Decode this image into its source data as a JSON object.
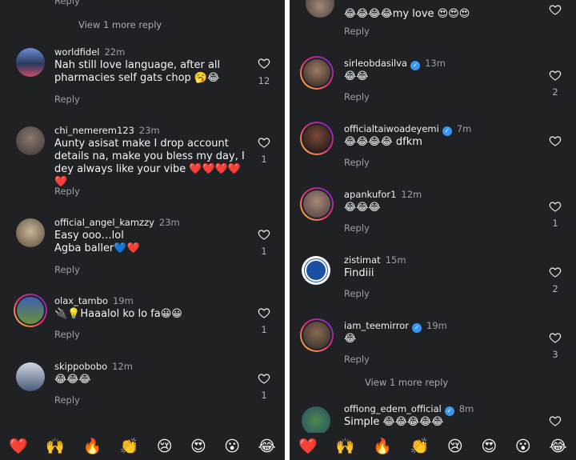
{
  "left": {
    "clipped_top_text": "Reply",
    "view_more": "View 1 more reply",
    "comments": [
      {
        "user": "worldfidel",
        "time": "22m",
        "text": "Nah still love language, after all pharmacies self gats chop 🥱😂",
        "reply": "Reply",
        "likes": "12",
        "verified": false
      },
      {
        "user": "chi_nemerem123",
        "time": "23m",
        "text": "Aunty asisat make I drop account details na, make you bless my day, I dey always like your vibe ❤️❤️❤️❤️❤️",
        "reply": "Reply",
        "likes": "1",
        "verified": false
      },
      {
        "user": "official_angel_kamzzy",
        "time": "23m",
        "text": "Easy ooo…lol\nAgba baller💙❤️",
        "reply": "Reply",
        "likes": "1",
        "verified": false
      },
      {
        "user": "olax_tambo",
        "time": "19m",
        "text": "🔌💡Haaalol ko lo fa😀😀",
        "reply": "Reply",
        "likes": "1",
        "verified": false
      },
      {
        "user": "skippobobo",
        "time": "12m",
        "text": "😂😂😂",
        "reply": "Reply",
        "likes": "1",
        "verified": false
      }
    ],
    "emojis": [
      "❤️",
      "🙌",
      "🔥",
      "👏",
      "😢",
      "😍",
      "😮",
      "😂"
    ]
  },
  "right": {
    "top_comment": {
      "text": "😂😂😂😂my love 😍😍😍",
      "reply": "Reply"
    },
    "view_more": "View 1 more reply",
    "comments": [
      {
        "user": "sirleobdasilva",
        "time": "13m",
        "text": "😂😂",
        "reply": "Reply",
        "likes": "2",
        "verified": true
      },
      {
        "user": "officialtaiwoadeyemi",
        "time": "7m",
        "text": "😂😂😂😂 dfkm",
        "reply": "Reply",
        "likes": "",
        "verified": true
      },
      {
        "user": "apankufor1",
        "time": "12m",
        "text": "😂😂😂",
        "reply": "Reply",
        "likes": "1",
        "verified": false
      },
      {
        "user": "zistimat",
        "time": "15m",
        "text": "Findiii",
        "reply": "Reply",
        "likes": "2",
        "verified": false
      },
      {
        "user": "iam_teemirror",
        "time": "19m",
        "text": "😂",
        "reply": "Reply",
        "likes": "3",
        "verified": true
      },
      {
        "user": "offiong_edem_official",
        "time": "8m",
        "text": "Simple 😂😂😂😂😂",
        "reply": "",
        "likes": "",
        "verified": true
      }
    ],
    "emojis": [
      "❤️",
      "🙌",
      "🔥",
      "👏",
      "😢",
      "😍",
      "😮",
      "😂"
    ]
  },
  "colors": {
    "background": "#1f2125",
    "verified": "#3897f0",
    "story_ring_start": "#f9ce34",
    "story_ring_end": "#6228d7"
  }
}
